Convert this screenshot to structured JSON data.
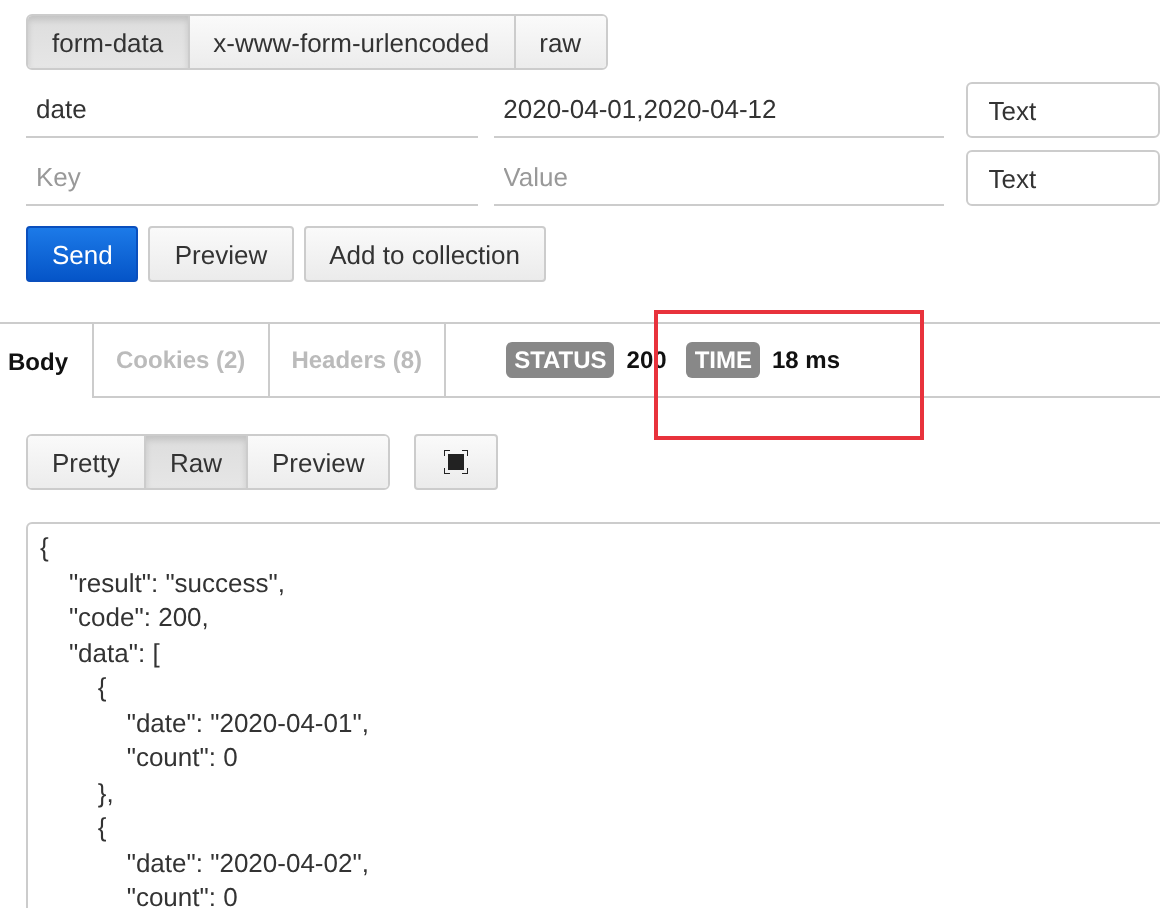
{
  "body_modes": [
    {
      "label": "form-data",
      "selected": true
    },
    {
      "label": "x-www-form-urlencoded",
      "selected": false
    },
    {
      "label": "raw",
      "selected": false
    }
  ],
  "params": [
    {
      "key": "date",
      "value": "2020-04-01,2020-04-12",
      "type": "Text"
    },
    {
      "key_placeholder": "Key",
      "value_placeholder": "Value",
      "type": "Text"
    }
  ],
  "actions": [
    {
      "label": "Send",
      "kind": "primary"
    },
    {
      "label": "Preview",
      "kind": "default"
    },
    {
      "label": "Add to collection",
      "kind": "default"
    }
  ],
  "response_tabs": [
    {
      "label": "Body",
      "selected": true
    },
    {
      "label": "Cookies (2)",
      "selected": false
    },
    {
      "label": "Headers (8)",
      "selected": false
    }
  ],
  "status": {
    "label": "STATUS",
    "value": "200"
  },
  "time": {
    "label": "TIME",
    "value": "18 ms",
    "highlighted": true
  },
  "view_modes": [
    {
      "label": "Pretty",
      "selected": false
    },
    {
      "label": "Raw",
      "selected": true
    },
    {
      "label": "Preview",
      "selected": false
    }
  ],
  "response_lines": [
    "{",
    "    \"result\": \"success\",",
    "    \"code\": 200,",
    "    \"data\": [",
    "        {",
    "            \"date\": \"2020-04-01\",",
    "            \"count\": 0",
    "        },",
    "        {",
    "            \"date\": \"2020-04-02\",",
    "            \"count\": 0"
  ]
}
